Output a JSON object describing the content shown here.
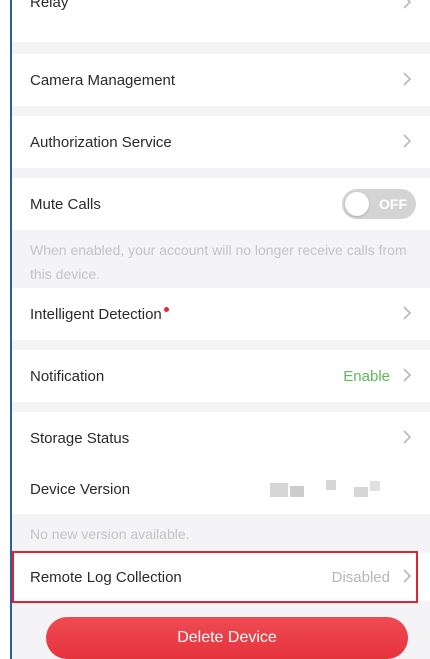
{
  "settings": {
    "relay": {
      "label": "Relay"
    },
    "camera_management": {
      "label": "Camera Management"
    },
    "authorization_service": {
      "label": "Authorization Service"
    },
    "mute_calls": {
      "label": "Mute Calls",
      "toggle_text": "OFF",
      "hint": "When enabled, your account will no longer receive calls from this device."
    },
    "intelligent_detection": {
      "label": "Intelligent Detection"
    },
    "notification": {
      "label": "Notification",
      "value": "Enable"
    },
    "storage_status": {
      "label": "Storage Status"
    },
    "device_version": {
      "label": "Device Version",
      "hint": "No new version available."
    },
    "remote_log_collection": {
      "label": "Remote Log Collection",
      "value": "Disabled"
    }
  },
  "delete_button": {
    "label": "Delete Device"
  },
  "colors": {
    "accent_red": "#e5333c",
    "highlight_border": "#e0242f",
    "enable_green": "#5fb85a",
    "background": "#f4f4f6"
  },
  "icons": {
    "chevron": "chevron-right-icon",
    "badge": "red-dot-icon"
  }
}
